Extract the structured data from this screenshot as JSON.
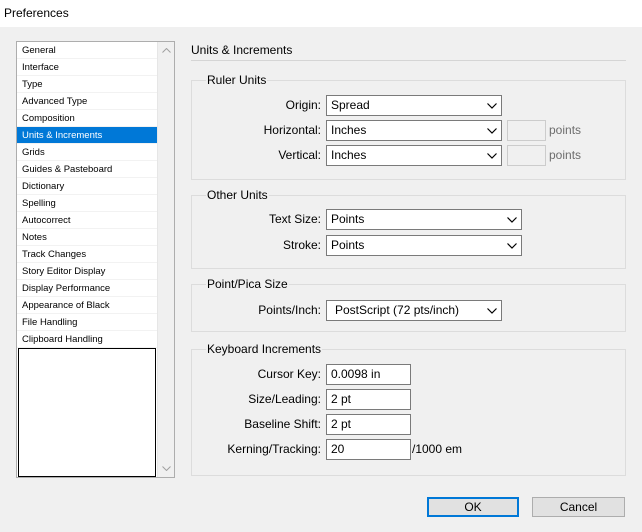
{
  "window": {
    "title": "Preferences"
  },
  "sidebar": {
    "items": [
      {
        "label": "General"
      },
      {
        "label": "Interface"
      },
      {
        "label": "Type"
      },
      {
        "label": "Advanced Type"
      },
      {
        "label": "Composition"
      },
      {
        "label": "Units & Increments",
        "selected": true
      },
      {
        "label": "Grids"
      },
      {
        "label": "Guides & Pasteboard"
      },
      {
        "label": "Dictionary"
      },
      {
        "label": "Spelling"
      },
      {
        "label": "Autocorrect"
      },
      {
        "label": "Notes"
      },
      {
        "label": "Track Changes"
      },
      {
        "label": "Story Editor Display"
      },
      {
        "label": "Display Performance"
      },
      {
        "label": "Appearance of Black"
      },
      {
        "label": "File Handling"
      },
      {
        "label": "Clipboard Handling"
      }
    ]
  },
  "panel": {
    "title": "Units & Increments",
    "ruler_units": {
      "title": "Ruler Units",
      "origin": {
        "label": "Origin:",
        "value": "Spread"
      },
      "horizontal": {
        "label": "Horizontal:",
        "value": "Inches",
        "points_value": "",
        "points_unit": "points"
      },
      "vertical": {
        "label": "Vertical:",
        "value": "Inches",
        "points_value": "",
        "points_unit": "points"
      }
    },
    "other_units": {
      "title": "Other Units",
      "text_size": {
        "label": "Text Size:",
        "value": "Points"
      },
      "stroke": {
        "label": "Stroke:",
        "value": "Points"
      }
    },
    "point_pica": {
      "title": "Point/Pica Size",
      "points_inch": {
        "label": "Points/Inch:",
        "value": "PostScript (72 pts/inch)"
      }
    },
    "keyboard_increments": {
      "title": "Keyboard Increments",
      "cursor_key": {
        "label": "Cursor Key:",
        "value": "0.0098 in"
      },
      "size_leading": {
        "label": "Size/Leading:",
        "value": "2 pt"
      },
      "baseline_shift": {
        "label": "Baseline Shift:",
        "value": "2 pt"
      },
      "kerning_tracking": {
        "label": "Kerning/Tracking:",
        "value": "20",
        "unit": "/1000 em"
      }
    }
  },
  "buttons": {
    "ok": "OK",
    "cancel": "Cancel"
  },
  "colors": {
    "accent": "#0078d7",
    "background": "#f0f0f0"
  }
}
